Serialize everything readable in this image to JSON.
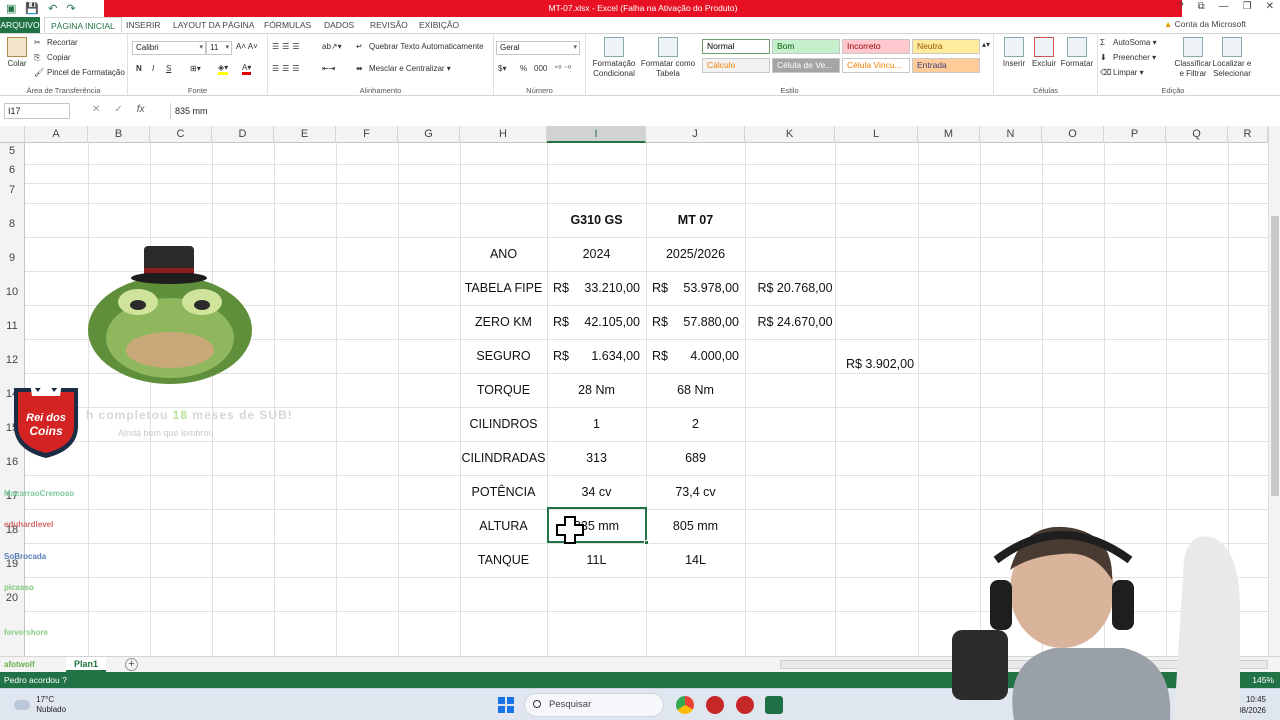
{
  "window": {
    "title": "MT-07.xlsx - Excel (Falha na Ativação do Produto)",
    "help": "?",
    "minimize": "—",
    "restore": "❐",
    "close": "✕"
  },
  "tabs": {
    "file": "ARQUIVO",
    "items": [
      "PÁGINA INICIAL",
      "INSERIR",
      "LAYOUT DA PÁGINA",
      "FÓRMULAS",
      "DADOS",
      "REVISÃO",
      "EXIBIÇÃO"
    ],
    "account": "Conta da Microsoft"
  },
  "ribbon": {
    "clipboard": {
      "paste": "Colar",
      "cut": "Recortar",
      "copy": "Copiar",
      "format_painter": "Pincel de Formatação",
      "label": "Área de Transferência"
    },
    "font": {
      "name": "Calibri",
      "size": "11",
      "bold": "N",
      "italic": "I",
      "underline": "S",
      "label": "Fonte"
    },
    "alignment": {
      "wrap": "Quebrar Texto Automaticamente",
      "merge": "Mesclar e Centralizar",
      "label": "Alinhamento"
    },
    "number": {
      "format": "Geral",
      "percent": "%",
      "thousands": "000",
      "label": "Número"
    },
    "styles": {
      "conditional": "Formatação Condicional",
      "table": "Formatar como Tabela",
      "boxes": [
        {
          "name": "Normal",
          "bg": "#ffffff",
          "fg": "#000000"
        },
        {
          "name": "Bom",
          "bg": "#c6efce",
          "fg": "#006100"
        },
        {
          "name": "Incorreto",
          "bg": "#ffc7ce",
          "fg": "#9c0006"
        },
        {
          "name": "Neutra",
          "bg": "#ffeb9c",
          "fg": "#9c5700"
        },
        {
          "name": "Cálculo",
          "bg": "#f2f2f2",
          "fg": "#fa7d00"
        },
        {
          "name": "Célula de Ve...",
          "bg": "#a5a5a5",
          "fg": "#ffffff"
        },
        {
          "name": "Célula Vincu...",
          "bg": "#ffffff",
          "fg": "#fa7d00"
        },
        {
          "name": "Entrada",
          "bg": "#ffcc99",
          "fg": "#3f3f76"
        }
      ],
      "label": "Estilo"
    },
    "cells": {
      "insert": "Inserir",
      "delete": "Excluir",
      "format": "Formatar",
      "label": "Células"
    },
    "editing": {
      "autosum": "AutoSoma",
      "fill": "Preencher",
      "clear": "Limpar",
      "sort": "Classificar e Filtrar",
      "find": "Localizar e Selecionar",
      "label": "Edição"
    }
  },
  "formula_bar": {
    "name_box": "I17",
    "fx": "fx",
    "value": "835 mm"
  },
  "columns": [
    "A",
    "B",
    "C",
    "D",
    "E",
    "F",
    "G",
    "H",
    "I",
    "J",
    "K",
    "L",
    "M",
    "N",
    "O",
    "P",
    "Q",
    "R"
  ],
  "rows": [
    "5",
    "6",
    "7",
    "8",
    "9",
    "10",
    "11",
    "12",
    "14",
    "15",
    "16",
    "17",
    "18",
    "19",
    "20"
  ],
  "table": {
    "headers": {
      "col1": "G310 GS",
      "col2": "MT 07"
    },
    "rows": [
      {
        "label": "ANO",
        "v1": "2024",
        "v2": "2025/2026"
      },
      {
        "label": "TABELA FIPE",
        "c1": "R$",
        "v1": "33.210,00",
        "c2": "R$",
        "v2": "53.978,00",
        "extra": "R$ 20.768,00"
      },
      {
        "label": "ZERO KM",
        "c1": "R$",
        "v1": "42.105,00",
        "c2": "R$",
        "v2": "57.880,00",
        "extra": "R$ 24.670,00"
      },
      {
        "label": "SEGURO",
        "c1": "R$",
        "v1": "1.634,00",
        "c2": "R$",
        "v2": "4.000,00",
        "extra2": "R$ 3.902,00"
      },
      {
        "label": "TORQUE",
        "v1": "28 Nm",
        "v2": "68 Nm"
      },
      {
        "label": "CILINDROS",
        "v1": "1",
        "v2": "2"
      },
      {
        "label": "CILINDRADAS",
        "v1": "313",
        "v2": "689"
      },
      {
        "label": "POTÊNCIA",
        "v1": "34 cv",
        "v2": "73,4 cv"
      },
      {
        "label": "ALTURA",
        "v1": "835 mm",
        "v2": "805 mm"
      },
      {
        "label": "TANQUE",
        "v1": "11L",
        "v2": "14L"
      }
    ]
  },
  "sheet": {
    "name": "Plan1",
    "add": "+"
  },
  "status": {
    "left": "Pedro acordou ?",
    "zoom": "145%"
  },
  "overlay": {
    "logo_line1": "Rei dos",
    "logo_line2": "Coins",
    "alert_line1_a": "h completou ",
    "alert_num": "18",
    "alert_line1_b": " meses de SUB!",
    "alert_line2": "Ainda bem que lembrou",
    "chat": [
      {
        "user": "MacarraoCremoso",
        "color": "#7cc9a0"
      },
      {
        "user": "eduhardlevel",
        "color": "#d46a6a"
      },
      {
        "user": "SoBrocada",
        "color": "#5b7fb8"
      },
      {
        "user": "picasso",
        "color": "#7cc97c"
      },
      {
        "user": "fervershore",
        "color": "#8bcf8b"
      },
      {
        "user": "afotwolf",
        "color": "#6ab04c"
      }
    ]
  },
  "taskbar": {
    "temp": "17°C",
    "weather": "Nublado",
    "search": "Pesquisar",
    "time": "10:45",
    "date": "10/08/2026"
  }
}
